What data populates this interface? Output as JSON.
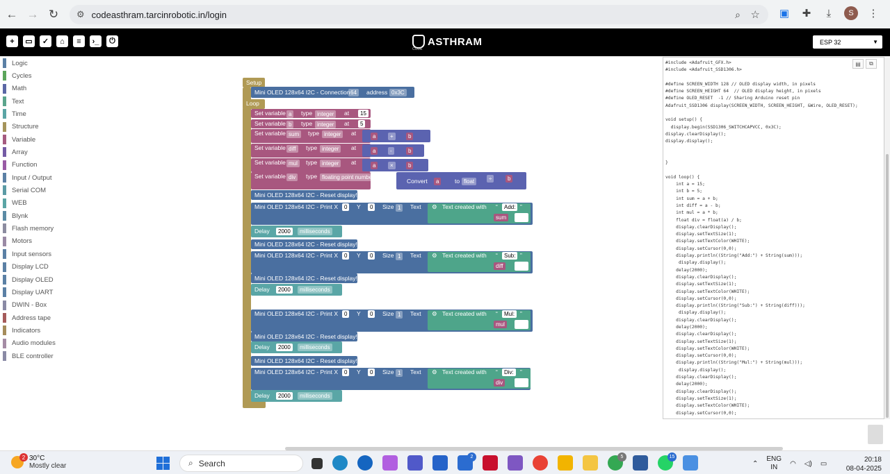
{
  "browser": {
    "url": "codeasthram.tarcinrobotic.in/login",
    "avatar_letter": "S"
  },
  "app": {
    "logo_text": "ASTHRAM",
    "logo_sub": "CODE",
    "board": "ESP 32"
  },
  "toolbox": [
    {
      "label": "Logic",
      "color": "#5b80a5"
    },
    {
      "label": "Cycles",
      "color": "#5ba55b"
    },
    {
      "label": "Math",
      "color": "#5b67a5"
    },
    {
      "label": "Text",
      "color": "#5ba58c"
    },
    {
      "label": "Time",
      "color": "#5ba5a5"
    },
    {
      "label": "Structure",
      "color": "#a5945b"
    },
    {
      "label": "Variable",
      "color": "#a55b80"
    },
    {
      "label": "Array",
      "color": "#745ba5"
    },
    {
      "label": "Function",
      "color": "#995ba5"
    },
    {
      "label": "Input / Output",
      "color": "#5b80a5"
    },
    {
      "label": "Serial COM",
      "color": "#5b9ba5"
    },
    {
      "label": "WEB",
      "color": "#5ba5a5"
    },
    {
      "label": "Blynk",
      "color": "#5b8ba5"
    },
    {
      "label": "Flash memory",
      "color": "#8c8ca0"
    },
    {
      "label": "Motors",
      "color": "#9a8aa5"
    },
    {
      "label": "Input sensors",
      "color": "#5b80a5"
    },
    {
      "label": "Display LCD",
      "color": "#5b80a5"
    },
    {
      "label": "Display OLED",
      "color": "#5b80a5"
    },
    {
      "label": "Display UART",
      "color": "#5b80a5"
    },
    {
      "label": "DWIN - Box",
      "color": "#8a8aa5"
    },
    {
      "label": "Address tape",
      "color": "#a55b5b"
    },
    {
      "label": "Indicators",
      "color": "#a58c5b"
    },
    {
      "label": "Audio modules",
      "color": "#a58ca5"
    },
    {
      "label": "BLE controller",
      "color": "#8a8aa5"
    }
  ],
  "blocks": {
    "setup": "Setup",
    "loop": "Loop",
    "connection": "Mini OLED 128x64 I2C - Connection",
    "connection_size": "64",
    "address_label": "address",
    "address_value": "0x3C",
    "set_variable": "Set variable",
    "type_label": "type",
    "at_label": "at",
    "variables": [
      {
        "name": "a",
        "type": "integer",
        "value": "15"
      },
      {
        "name": "b",
        "type": "integer",
        "value": "5"
      },
      {
        "name": "sum",
        "type": "integer",
        "left": "a",
        "op": "+",
        "right": "b"
      },
      {
        "name": "diff",
        "type": "integer",
        "left": "a",
        "op": "-",
        "right": "b"
      },
      {
        "name": "mul",
        "type": "integer",
        "left": "a",
        "op": "×",
        "right": "b"
      },
      {
        "name": "div",
        "type": "floating point number",
        "convert": "Convert",
        "to": "to",
        "float": "float",
        "left": "a",
        "op": "÷",
        "right": "b"
      }
    ],
    "reset_display": "Mini OLED 128x64 I2C - Reset display!",
    "print_label": "Mini OLED 128x64 I2C - Print X",
    "x_value": "0",
    "y_label": "Y",
    "y_value": "0",
    "size_label": "Size",
    "size_value": "1",
    "text_label": "Text",
    "text_created": "Text created with",
    "quote_open": "“",
    "quote_close": "”",
    "prints": [
      {
        "text": "Add:",
        "var": "sum"
      },
      {
        "text": "Sub:",
        "var": "diff"
      },
      {
        "text": "Mul:",
        "var": "mul"
      },
      {
        "text": "Div:",
        "var": "div"
      }
    ],
    "delay_label": "Delay",
    "delay_value": "2000",
    "delay_unit": "milliseconds"
  },
  "code": "#include <Adafruit_GFX.h>\n#include <Adafruit_SSD1306.h>\n\n#define SCREEN_WIDTH 128 // OLED display width, in pixels\n#define SCREEN_HEIGHT 64  // OLED display height, in pixels\n#define OLED_RESET  -1 // Sharing Arduino reset pin\nAdafruit_SSD1306 display(SCREEN_WIDTH, SCREEN_HEIGHT, &Wire, OLED_RESET);\n\nvoid setup() {\n  display.begin(SSD1306_SWITCHCAPVCC, 0x3C);\ndisplay.clearDisplay();\ndisplay.display();\n\n\n}\n\nvoid loop() {\n    int a = 15;\n    int b = 5;\n    int sum = a + b;\n    int diff = a - b;\n    int mul = a * b;\n    float div = float(a) / b;\n    display.clearDisplay();\n    display.setTextSize(1);\n    display.setTextColor(WHITE);\n    display.setCursor(0,0);\n    display.println((String(\"Add:\") + String(sum)));\n     display.display();\n    delay(2000);\n    display.clearDisplay();\n    display.setTextSize(1);\n    display.setTextColor(WHITE);\n    display.setCursor(0,0);\n    display.println((String(\"Sub:\") + String(diff)));\n     display.display();\n    display.clearDisplay();\n    delay(2000);\n    display.clearDisplay();\n    display.setTextSize(1);\n    display.setTextColor(WHITE);\n    display.setCursor(0,0);\n    display.println((String(\"Mul:\") + String(mul)));\n     display.display();\n    display.clearDisplay();\n    delay(2000);\n    display.clearDisplay();\n    display.setTextSize(1);\n    display.setTextColor(WHITE);\n    display.setCursor(0,0);",
  "taskbar": {
    "temp": "30°C",
    "weather": "Mostly clear",
    "weather_badge": "2",
    "search": "Search",
    "badge_todo": "2",
    "badge_chrome": "5",
    "badge_whatsapp": "15",
    "lang1": "ENG",
    "lang2": "IN",
    "time": "20:18",
    "date": "08-04-2025"
  }
}
